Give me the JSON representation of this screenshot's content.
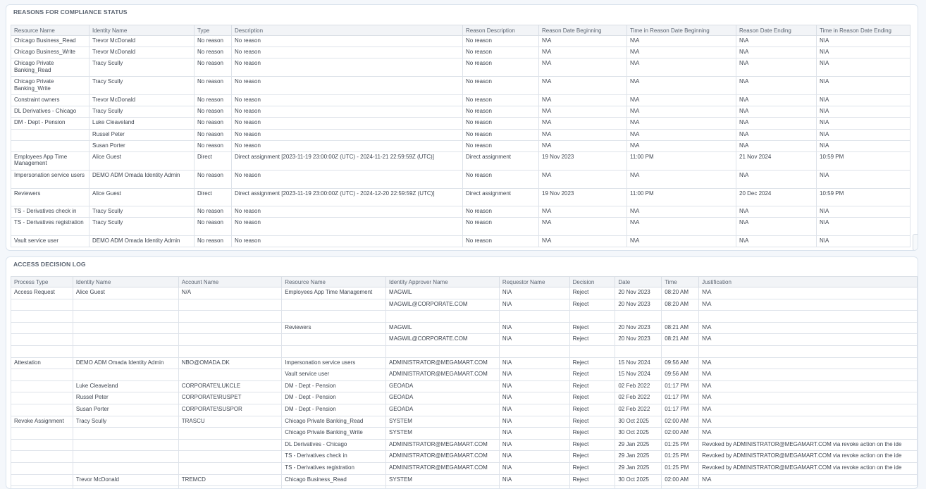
{
  "reasons": {
    "title": "REASONS FOR COMPLIANCE STATUS",
    "columns": [
      "Resource Name",
      "Identity Name",
      "Type",
      "Description",
      "Reason Description",
      "Reason Date Beginning",
      "Time in Reason Date Beginning",
      "Reason Date Ending",
      "Time in Reason Date Ending"
    ],
    "rows": [
      [
        "Chicago Business_Read",
        "Trevor McDonald",
        "No reason",
        "No reason",
        "No reason",
        "N\\A",
        "N\\A",
        "N\\A",
        "N\\A"
      ],
      [
        "Chicago Business_Write",
        "Trevor McDonald",
        "No reason",
        "No reason",
        "No reason",
        "N\\A",
        "N\\A",
        "N\\A",
        "N\\A"
      ],
      [
        "Chicago Private Banking_Read",
        "Tracy Scully",
        "No reason",
        "No reason",
        "No reason",
        "N\\A",
        "N\\A",
        "N\\A",
        "N\\A"
      ],
      [
        "Chicago Private Banking_Write",
        "Tracy Scully",
        "No reason",
        "No reason",
        "No reason",
        "N\\A",
        "N\\A",
        "N\\A",
        "N\\A"
      ],
      [
        "Constraint owners",
        "Trevor McDonald",
        "No reason",
        "No reason",
        "No reason",
        "N\\A",
        "N\\A",
        "N\\A",
        "N\\A"
      ],
      [
        "DL Derivatives - Chicago",
        "Tracy Scully",
        "No reason",
        "No reason",
        "No reason",
        "N\\A",
        "N\\A",
        "N\\A",
        "N\\A"
      ],
      [
        "DM - Dept - Pension",
        "Luke Cleaveland",
        "No reason",
        "No reason",
        "No reason",
        "N\\A",
        "N\\A",
        "N\\A",
        "N\\A"
      ],
      [
        "",
        "Russel Peter",
        "No reason",
        "No reason",
        "No reason",
        "N\\A",
        "N\\A",
        "N\\A",
        "N\\A"
      ],
      [
        "",
        "Susan Porter",
        "No reason",
        "No reason",
        "No reason",
        "N\\A",
        "N\\A",
        "N\\A",
        "N\\A"
      ],
      [
        "Employees App Time Management",
        "Alice Guest",
        "Direct",
        "Direct assignment [2023-11-19 23:00:00Z (UTC) - 2024-11-21 22:59:59Z (UTC)]",
        "Direct assignment",
        "19 Nov 2023",
        "11:00 PM",
        "21 Nov 2024",
        "10:59 PM"
      ],
      [
        "Impersonation service users",
        "DEMO ADM Omada Identity Admin",
        "No reason",
        "No reason",
        "No reason",
        "N\\A",
        "N\\A",
        "N\\A",
        "N\\A"
      ],
      [
        "Reviewers",
        "Alice Guest",
        "Direct",
        "Direct assignment [2023-11-19 23:00:00Z (UTC) - 2024-12-20 22:59:59Z (UTC)]",
        "Direct assignment",
        "19 Nov 2023",
        "11:00 PM",
        "20 Dec 2024",
        "10:59 PM"
      ],
      [
        "TS - Derivatives check in",
        "Tracy Scully",
        "No reason",
        "No reason",
        "No reason",
        "N\\A",
        "N\\A",
        "N\\A",
        "N\\A"
      ],
      [
        "TS - Derivatives registration",
        "Tracy Scully",
        "No reason",
        "No reason",
        "No reason",
        "N\\A",
        "N\\A",
        "N\\A",
        "N\\A"
      ],
      [
        "Vault service user",
        "DEMO ADM Omada Identity Admin",
        "No reason",
        "No reason",
        "No reason",
        "N\\A",
        "N\\A",
        "N\\A",
        "N\\A"
      ]
    ]
  },
  "log": {
    "title": "ACCESS DECISION LOG",
    "columns": [
      "Process Type",
      "Identity Name",
      "Account Name",
      "Resource Name",
      "Identity Approver Name",
      "Requestor Name",
      "Decision",
      "Date",
      "Time",
      "Justification"
    ],
    "rows": [
      [
        "Access Request",
        "Alice Guest",
        "N/A",
        "Employees App Time Management",
        "MAGWIL",
        "N\\A",
        "Reject",
        "20 Nov 2023",
        "08:20 AM",
        "N\\A"
      ],
      [
        "",
        "",
        "",
        "",
        "MAGWIL@CORPORATE.COM",
        "N\\A",
        "Reject",
        "20 Nov 2023",
        "08:20 AM",
        "N\\A"
      ],
      [
        "",
        "",
        "",
        "",
        "",
        "",
        "",
        "",
        "",
        ""
      ],
      [
        "",
        "",
        "",
        "Reviewers",
        "MAGWIL",
        "N\\A",
        "Reject",
        "20 Nov 2023",
        "08:21 AM",
        "N\\A"
      ],
      [
        "",
        "",
        "",
        "",
        "MAGWIL@CORPORATE.COM",
        "N\\A",
        "Reject",
        "20 Nov 2023",
        "08:21 AM",
        "N\\A"
      ],
      [
        "",
        "",
        "",
        "",
        "",
        "",
        "",
        "",
        "",
        ""
      ],
      [
        "Attestation",
        "DEMO ADM Omada Identity Admin",
        "NBO@OMADA.DK",
        "Impersonation service users",
        "ADMINISTRATOR@MEGAMART.COM",
        "N\\A",
        "Reject",
        "15 Nov 2024",
        "09:56 AM",
        "N\\A"
      ],
      [
        "",
        "",
        "",
        "Vault service user",
        "ADMINISTRATOR@MEGAMART.COM",
        "N\\A",
        "Reject",
        "15 Nov 2024",
        "09:56 AM",
        "N\\A"
      ],
      [
        "",
        "Luke Cleaveland",
        "CORPORATE\\LUKCLE",
        "DM - Dept - Pension",
        "GEOADA",
        "N\\A",
        "Reject",
        "02 Feb 2022",
        "01:17 PM",
        "N\\A"
      ],
      [
        "",
        "Russel Peter",
        "CORPORATE\\RUSPET",
        "DM - Dept - Pension",
        "GEOADA",
        "N\\A",
        "Reject",
        "02 Feb 2022",
        "01:17 PM",
        "N\\A"
      ],
      [
        "",
        "Susan Porter",
        "CORPORATE\\SUSPOR",
        "DM - Dept - Pension",
        "GEOADA",
        "N\\A",
        "Reject",
        "02 Feb 2022",
        "01:17 PM",
        "N\\A"
      ],
      [
        "Revoke Assignment",
        "Tracy Scully",
        "TRASCU",
        "Chicago Private Banking_Read",
        "SYSTEM",
        "N\\A",
        "Reject",
        "30 Oct 2025",
        "02:00 AM",
        "N\\A"
      ],
      [
        "",
        "",
        "",
        "Chicago Private Banking_Write",
        "SYSTEM",
        "N\\A",
        "Reject",
        "30 Oct 2025",
        "02:00 AM",
        "N\\A"
      ],
      [
        "",
        "",
        "",
        "DL Derivatives - Chicago",
        "ADMINISTRATOR@MEGAMART.COM",
        "N\\A",
        "Reject",
        "29 Jan 2025",
        "01:25 PM",
        "Revoked by ADMINISTRATOR@MEGAMART.COM via revoke action on the ide"
      ],
      [
        "",
        "",
        "",
        "TS - Derivatives check in",
        "ADMINISTRATOR@MEGAMART.COM",
        "N\\A",
        "Reject",
        "29 Jan 2025",
        "01:25 PM",
        "Revoked by ADMINISTRATOR@MEGAMART.COM via revoke action on the ide"
      ],
      [
        "",
        "",
        "",
        "TS - Derivatives registration",
        "ADMINISTRATOR@MEGAMART.COM",
        "N\\A",
        "Reject",
        "29 Jan 2025",
        "01:25 PM",
        "Revoked by ADMINISTRATOR@MEGAMART.COM via revoke action on the ide"
      ],
      [
        "",
        "Trevor McDonald",
        "TREMCD",
        "Chicago Business_Read",
        "SYSTEM",
        "N\\A",
        "Reject",
        "30 Oct 2025",
        "02:00 AM",
        "N\\A"
      ],
      [
        "",
        "",
        "",
        "",
        "",
        "",
        "",
        "",
        "",
        ""
      ]
    ]
  }
}
